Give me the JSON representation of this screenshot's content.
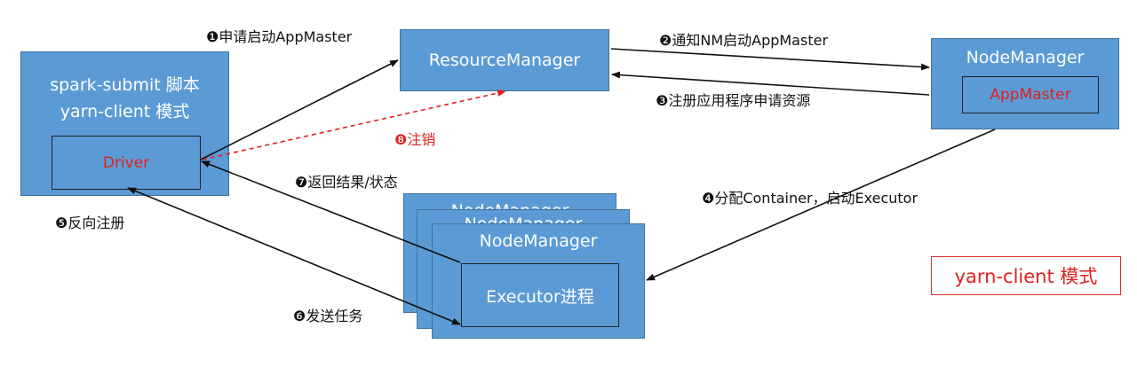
{
  "nodes": {
    "client": {
      "line1": "spark-submit 脚本",
      "line2": "yarn-client 模式"
    },
    "driver": {
      "label": "Driver"
    },
    "resource_manager": {
      "label": "ResourceManager"
    },
    "node_manager_top": {
      "label": "NodeManager"
    },
    "app_master": {
      "label": "AppMaster"
    },
    "node_manager_stack": {
      "back1": "NodeManager",
      "back2": "NodeManager",
      "front": "NodeManager"
    },
    "executor": {
      "label": "Executor进程"
    }
  },
  "steps": {
    "s1": {
      "num": "❶",
      "text": "申请启动AppMaster"
    },
    "s2": {
      "num": "❷",
      "text": "通知NM启动AppMaster"
    },
    "s3": {
      "num": "❸",
      "text": "注册应用程序申请资源"
    },
    "s4": {
      "num": "❹",
      "text": "分配Container，启动Executor"
    },
    "s5": {
      "num": "❺",
      "text": "反向注册"
    },
    "s6": {
      "num": "❻",
      "text": "发送任务"
    },
    "s7": {
      "num": "❼",
      "text": "返回结果/状态"
    },
    "s8": {
      "num": "❽",
      "text": "注销"
    }
  },
  "mode_label": "yarn-client 模式",
  "colors": {
    "box_fill": "#5b9bd5",
    "box_border": "#41719c",
    "red": "#e02020",
    "arrow": "#111111"
  }
}
